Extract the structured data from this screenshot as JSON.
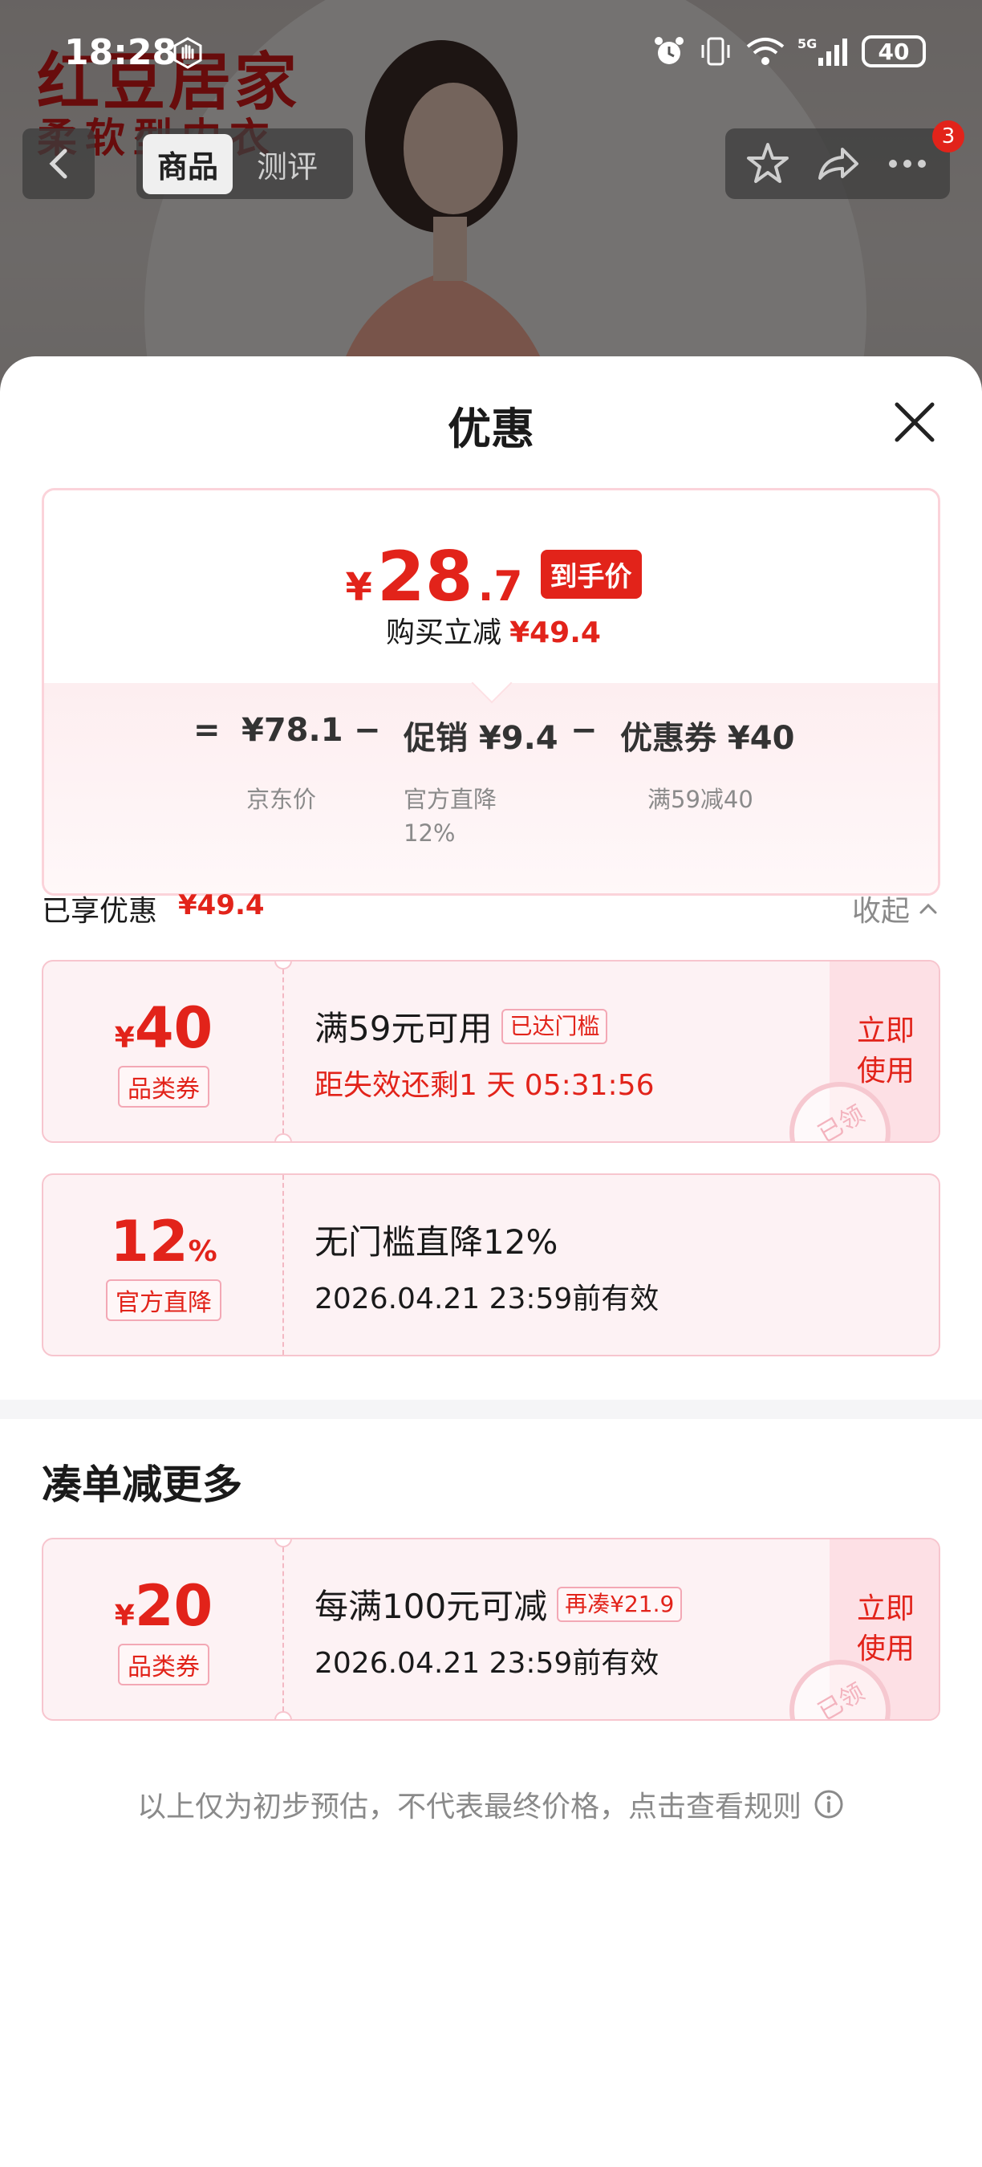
{
  "status_bar": {
    "time": "18:28",
    "network": "5G",
    "battery": "40"
  },
  "background_page": {
    "brand_line1": "红豆居家",
    "brand_line2": "柔软型内衣",
    "tabs": [
      {
        "label": "商品",
        "active": true
      },
      {
        "label": "测评",
        "active": false
      }
    ],
    "cart_badge": "3"
  },
  "sheet": {
    "title": "优惠",
    "final_price": {
      "currency": "¥",
      "integer": "28",
      "decimal": ".7",
      "tag": "到手价"
    },
    "savings": {
      "label": "购买立减",
      "amount": "¥49.4"
    },
    "formula": {
      "equals": "=",
      "base_price": "¥78.1",
      "base_label": "京东价",
      "minus1": "−",
      "promo": "促销 ¥9.4",
      "promo_label_line1": "官方直降",
      "promo_label_line2": "12%",
      "minus2": "−",
      "coupon": "优惠券 ¥40",
      "coupon_label": "满59减40"
    },
    "enjoyed": {
      "label": "已享优惠",
      "amount": "¥49.4",
      "collapse_label": "收起"
    },
    "coupons": [
      {
        "yen": "¥",
        "amount": "40",
        "type": "品类券",
        "title": "满59元可用",
        "chip": "已达门槛",
        "detail": "距失效还剩1 天 05:31:56",
        "action": "立即使用",
        "stamp": "已领"
      },
      {
        "amount": "12",
        "unit": "%",
        "type": "官方直降",
        "title": "无门槛直降12%",
        "detail": "2026.04.21 23:59前有效"
      }
    ],
    "more_section": {
      "title": "凑单减更多",
      "coupon": {
        "yen": "¥",
        "amount": "20",
        "type": "品类券",
        "title": "每满100元可减",
        "chip": "再凑¥21.9",
        "detail": "2026.04.21 23:59前有效",
        "action": "立即使用",
        "stamp": "已领"
      }
    },
    "footer_note": "以上仅为初步预估，不代表最终价格，点击查看规则"
  },
  "colors": {
    "accent_red": "#e2231a",
    "coupon_bg": "#fdf2f4",
    "coupon_border": "#f7c5ce"
  }
}
